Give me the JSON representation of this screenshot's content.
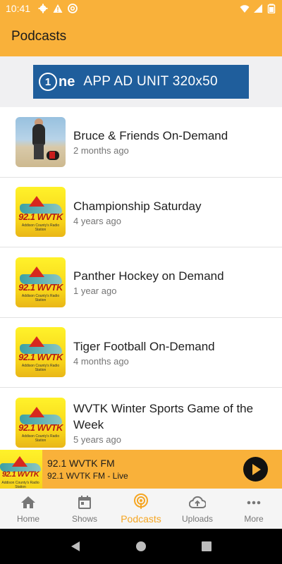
{
  "status_bar": {
    "time": "10:41",
    "icons": [
      "gear-icon",
      "alert-icon",
      "at-icon",
      "wifi-icon",
      "signal-icon",
      "battery-icon"
    ]
  },
  "app_bar": {
    "title": "Podcasts"
  },
  "ad": {
    "logo_text": "ne",
    "logo_digit": "1",
    "label": "APP AD UNIT 320x50"
  },
  "podcasts": [
    {
      "title": "Bruce & Friends On-Demand",
      "age": "2 months ago",
      "thumb": "photo"
    },
    {
      "title": "Championship Saturday",
      "age": "4 years ago",
      "thumb": "wvtk"
    },
    {
      "title": "Panther Hockey on Demand",
      "age": "1 year ago",
      "thumb": "wvtk"
    },
    {
      "title": "Tiger Football On-Demand",
      "age": "4 months ago",
      "thumb": "wvtk"
    },
    {
      "title": "WVTK Winter Sports Game of the Week",
      "age": "5 years ago",
      "thumb": "wvtk"
    }
  ],
  "logo": {
    "freq": "92.1 WVTK",
    "tagline": "Addison County's Radio Station"
  },
  "player": {
    "title": "92.1 WVTK FM",
    "subtitle": "92.1 WVTK FM - Live",
    "action_icon": "play-icon"
  },
  "nav": {
    "items": [
      {
        "label": "Home",
        "icon": "home-icon",
        "active": false
      },
      {
        "label": "Shows",
        "icon": "calendar-icon",
        "active": false
      },
      {
        "label": "Podcasts",
        "icon": "podcast-icon",
        "active": true
      },
      {
        "label": "Uploads",
        "icon": "cloud-upload-icon",
        "active": false
      },
      {
        "label": "More",
        "icon": "more-icon",
        "active": false
      }
    ]
  },
  "colors": {
    "accent": "#F9B13A",
    "active_tab": "#F5A623",
    "ad_background": "#1f5e9c"
  }
}
